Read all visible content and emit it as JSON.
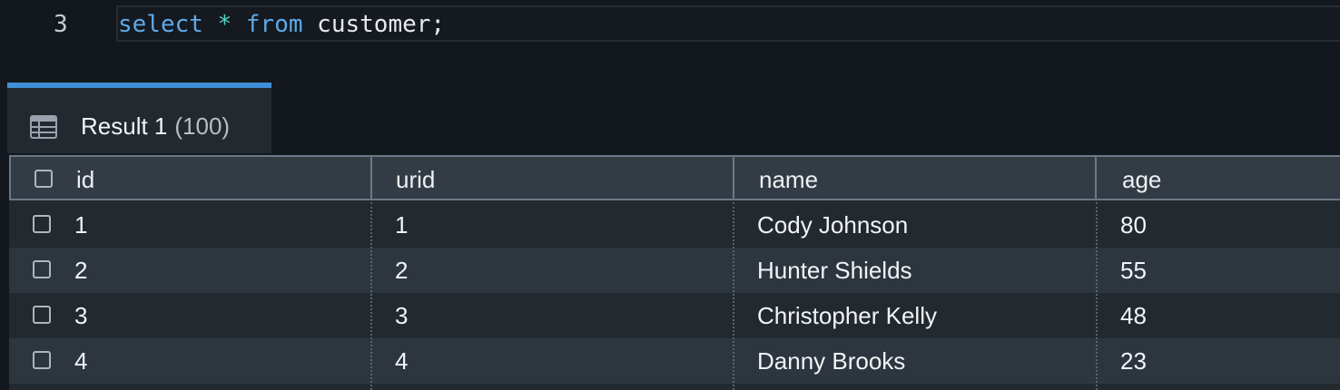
{
  "editor": {
    "line_number": "3",
    "code": {
      "kw_select": "select",
      "op_star": "*",
      "kw_from": "from",
      "table": "customer",
      "semicolon": ";"
    }
  },
  "result_tab": {
    "label": "Result 1",
    "count": "(100)",
    "icon": "table-icon"
  },
  "colors": {
    "tab_accent": "#3f8fd6",
    "keyword": "#5ea9e8",
    "operator": "#4fd6c8"
  },
  "table": {
    "columns": [
      "id",
      "urid",
      "name",
      "age"
    ],
    "rows": [
      {
        "id": "1",
        "urid": "1",
        "name": "Cody Johnson",
        "age": "80"
      },
      {
        "id": "2",
        "urid": "2",
        "name": "Hunter Shields",
        "age": "55"
      },
      {
        "id": "3",
        "urid": "3",
        "name": "Christopher Kelly",
        "age": "48"
      },
      {
        "id": "4",
        "urid": "4",
        "name": "Danny Brooks",
        "age": "23"
      }
    ]
  }
}
